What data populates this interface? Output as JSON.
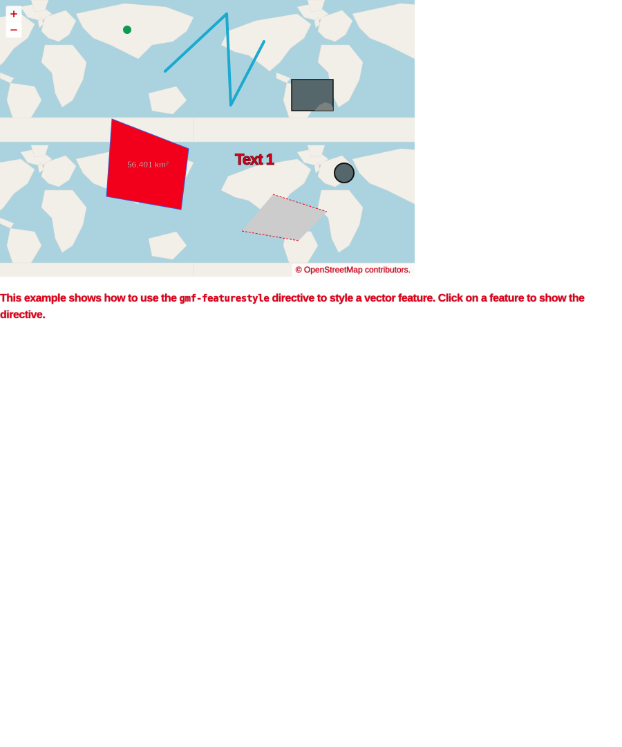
{
  "map": {
    "zoom_in_label": "+",
    "zoom_out_label": "−",
    "feature_text_label": "Text 1",
    "polygon_area_label": "56,401 km²",
    "attribution": {
      "copyright": "© ",
      "link_text": "OpenStreetMap",
      "suffix": " contributors."
    },
    "colors": {
      "water": "#aad3df",
      "land": "#f2efe9",
      "line": "#1aa9cf",
      "red_polygon": "#f2001b",
      "gray_polygon": "#cccccc",
      "dark_shape": "#56676b",
      "point": "#0c9b4e"
    }
  },
  "description": {
    "before": "This example shows how to use the ",
    "code": "gmf-featurestyle",
    "after": " directive to style a vector feature. Click on a feature to show the directive."
  }
}
